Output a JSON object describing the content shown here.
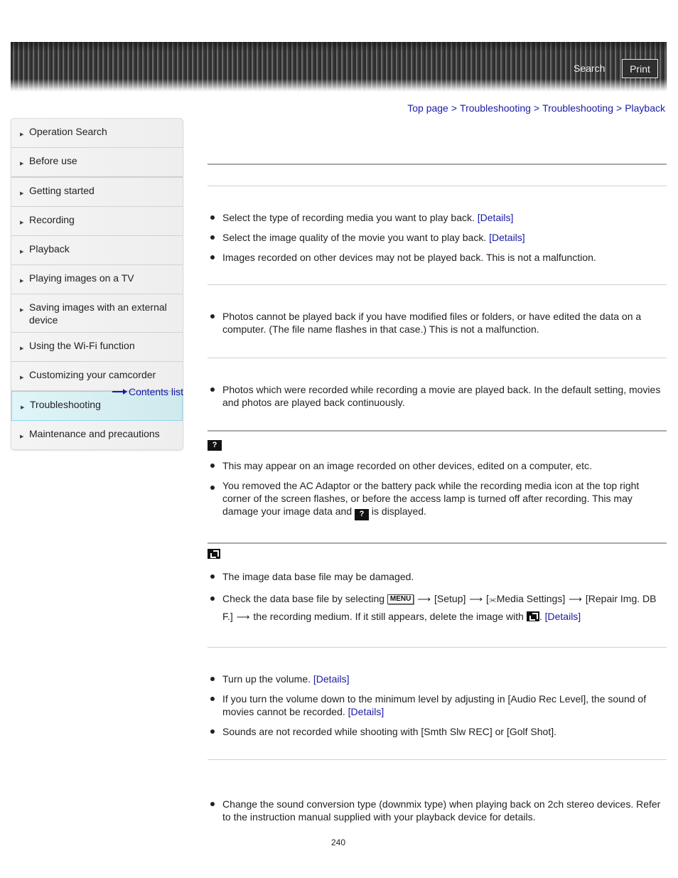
{
  "header": {
    "search_label": "Search",
    "print_label": "Print"
  },
  "breadcrumb": {
    "items": [
      "Top page",
      "Troubleshooting",
      "Troubleshooting",
      "Playback"
    ],
    "separator": ">"
  },
  "sidebar": {
    "items": [
      {
        "label": "Operation Search"
      },
      {
        "label": "Before use"
      },
      {
        "label": "Getting started"
      },
      {
        "label": "Recording"
      },
      {
        "label": "Playback"
      },
      {
        "label": "Playing images on a TV"
      },
      {
        "label": "Saving images with an external device"
      },
      {
        "label": "Using the Wi-Fi function"
      },
      {
        "label": "Customizing your camcorder"
      },
      {
        "label": "Troubleshooting",
        "active": true
      },
      {
        "label": "Maintenance and precautions"
      }
    ],
    "contents_list_label": "Contents list"
  },
  "sections": {
    "s1": {
      "bullets": [
        {
          "text": "Select the type of recording media you want to play back.",
          "link": "[Details]"
        },
        {
          "text": "Select the image quality of the movie you want to play back.",
          "link": "[Details]"
        },
        {
          "text": "Images recorded on other devices may not be played back. This is not a malfunction."
        }
      ]
    },
    "s2": {
      "bullets": [
        {
          "text": "Photos cannot be played back if you have modified files or folders, or have edited the data on a computer. (The file name flashes in that case.) This is not a malfunction."
        }
      ]
    },
    "s3": {
      "bullets": [
        {
          "text": "Photos which were recorded while recording a movie are played back. In the default setting, movies and photos are played back continuously."
        }
      ]
    },
    "s4": {
      "heading_icon": "question-mark-icon",
      "heading_icon_glyph": "?",
      "bullets": [
        {
          "text": "This may appear on an image recorded on other devices, edited on a computer, etc."
        },
        {
          "text_before": "You removed the AC Adaptor or the battery pack while the recording media icon at the top right corner of the screen flashes, or before the access lamp is turned off after recording. This may damage your image data and",
          "text_after": "is displayed."
        }
      ]
    },
    "s5": {
      "heading_icon": "database-repair-icon",
      "bullets": [
        {
          "text": "The image data base file may be damaged."
        },
        {
          "p1": "Check the data base file by selecting",
          "menu_key": "MENU",
          "p2": "[Setup]",
          "p3": "[",
          "media_glyph": "⫘",
          "p4": "Media Settings]",
          "p5": "[Repair Img. DB F.]",
          "p6": "the recording medium. If it still appears, delete the image with",
          "p7": ".",
          "link": "[Details]"
        }
      ]
    },
    "s6": {
      "bullets": [
        {
          "text": "Turn up the volume.",
          "link": "[Details]"
        },
        {
          "text": "If you turn the volume down to the minimum level by adjusting in [Audio Rec Level], the sound of movies cannot be recorded.",
          "link": "[Details]"
        },
        {
          "text": "Sounds are not recorded while shooting with [Smth Slw REC] or [Golf Shot]."
        }
      ]
    },
    "s7": {
      "bullets": [
        {
          "text": "Change the sound conversion type (downmix type) when playing back on 2ch stereo devices. Refer to the instruction manual supplied with your playback device for details."
        }
      ]
    }
  },
  "arrow_glyph": "⟶",
  "page_number": "240"
}
